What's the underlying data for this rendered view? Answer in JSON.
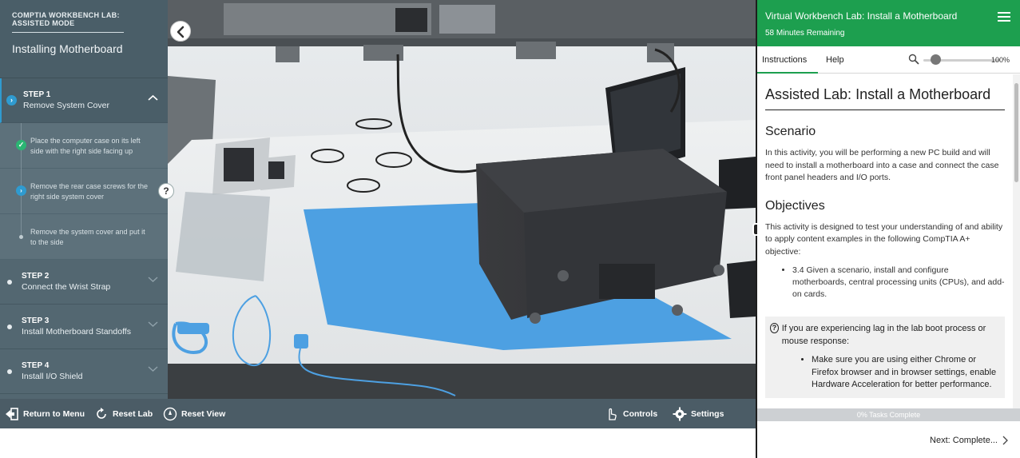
{
  "left_panel": {
    "mode_label": "COMPTIA WORKBENCH LAB: ASSISTED MODE",
    "lab_title": "Installing Motherboard",
    "steps": [
      {
        "number": "STEP 1",
        "name": "Remove System Cover",
        "substeps": [
          "Place the computer case on its left side with the right side facing up",
          "Remove the rear case screws for the right side system cover",
          "Remove the system cover and put it to the side"
        ]
      },
      {
        "number": "STEP 2",
        "name": "Connect the Wrist Strap"
      },
      {
        "number": "STEP 3",
        "name": "Install Motherboard Standoffs"
      },
      {
        "number": "STEP 4",
        "name": "Install I/O Shield"
      }
    ],
    "help_glyph": "?"
  },
  "toolbar": {
    "return_label": "Return to Menu",
    "reset_lab_label": "Reset Lab",
    "reset_view_label": "Reset View",
    "controls_label": "Controls",
    "settings_label": "Settings"
  },
  "right_panel": {
    "title": "Virtual Workbench Lab: Install a Motherboard",
    "time_remaining": "58 Minutes Remaining",
    "tabs": {
      "instructions": "Instructions",
      "help": "Help"
    },
    "zoom_value": "100%",
    "content": {
      "heading": "Assisted Lab: Install a Motherboard",
      "scenario_title": "Scenario",
      "scenario_text": "In this activity, you will be performing a new PC build and will need to install a motherboard into a case and connect the case front panel headers and I/O ports.",
      "objectives_title": "Objectives",
      "objectives_text": "This activity is designed to test your understanding of and ability to apply content examples in the following CompTIA A+ objective:",
      "objective_item": "3.4 Given a scenario, install and configure motherboards, central processing units (CPUs), and add-on cards.",
      "lag_intro": "If you are experiencing lag in the lab boot process or mouse response:",
      "lag_item": "Make sure you are using either Chrome or Firefox browser and in browser settings, enable Hardware Acceleration for better performance."
    },
    "progress_text": "0% Tasks Complete",
    "next_label": "Next: Complete..."
  },
  "icons": {
    "back": "chevron-left-icon",
    "menu": "hamburger-menu-icon",
    "zoom": "magnifier-icon"
  },
  "colors": {
    "accent_green": "#1d9f4f",
    "step_blue": "#2f9bd0",
    "check_green": "#2bb673",
    "panel_slate": "#536771",
    "toolbar_slate": "#4b5c66"
  }
}
